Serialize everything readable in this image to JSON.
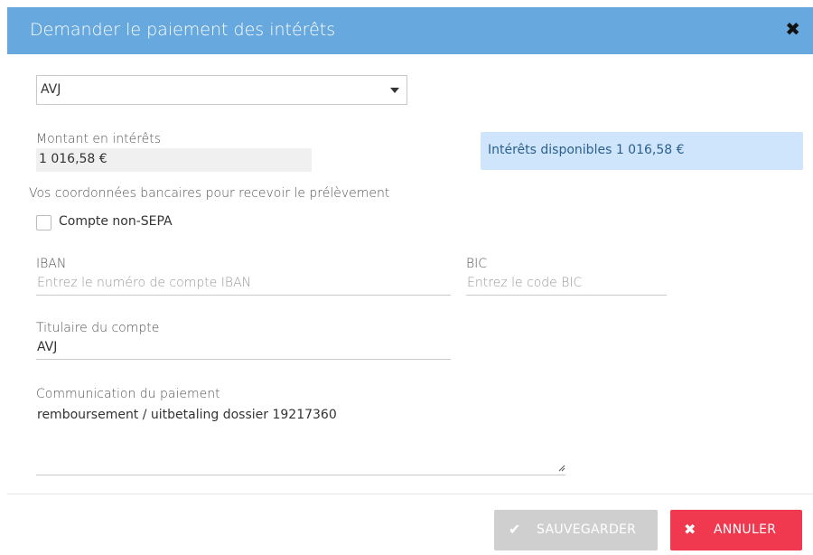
{
  "dialog": {
    "title": "Demander le paiement des intérêts",
    "close_symbol": "✖"
  },
  "account_select": {
    "selected": "AVJ"
  },
  "amount": {
    "label": "Montant en intérêts",
    "value": "1 016,58 €"
  },
  "info_box": {
    "text": "Intérêts disponibles 1 016,58 €"
  },
  "bank": {
    "section_label": "Vos coordonnées bancaires pour recevoir le prélèvement",
    "non_sepa_label": "Compte non-SEPA",
    "iban_label": "IBAN",
    "iban_placeholder": "Entrez le numéro de compte IBAN",
    "bic_label": "BIC",
    "bic_placeholder": "Entrez le code BIC",
    "holder_label": "Titulaire du compte",
    "holder_value": "AVJ",
    "communication_label": "Communication du paiement",
    "communication_value": "remboursement / uitbetaling dossier 19217360"
  },
  "buttons": {
    "save_label": "SAUVEGARDER",
    "cancel_label": "ANNULER",
    "save_icon": "✔",
    "cancel_icon": "✖"
  },
  "colors": {
    "header": "#67a9de",
    "info_bg": "#cfe5fb",
    "save_disabled": "#cfcfcf",
    "cancel": "#f0394f"
  }
}
